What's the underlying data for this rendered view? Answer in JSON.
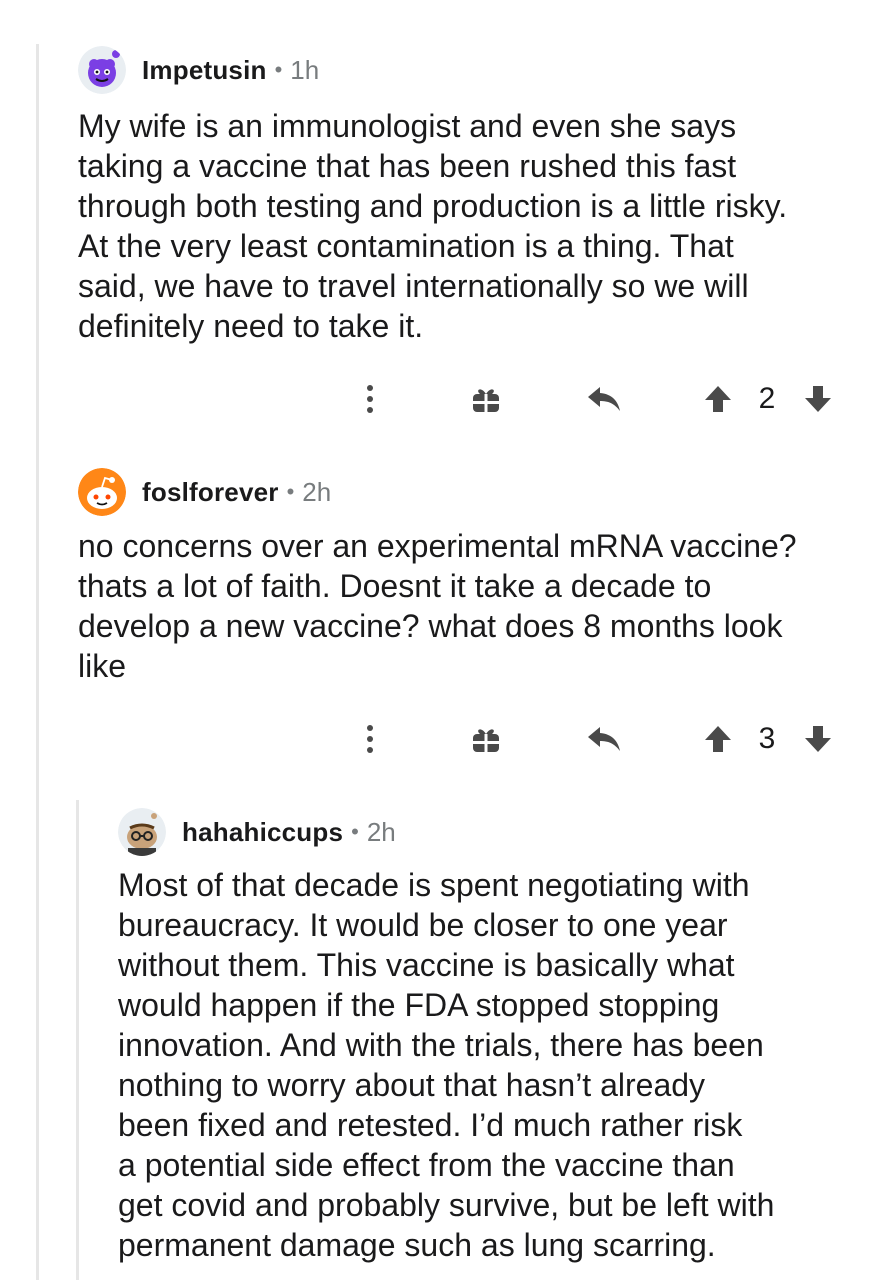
{
  "comments": [
    {
      "username": "Impetusin",
      "separator": "•",
      "time": "1h",
      "avatar_icon": "snoo-avatar-purple-icon",
      "body": "My wife is an immunologist and even she says\ntaking a vaccine that has been rushed this fast\nthrough both testing and production is a little risky.\nAt the very least contamination is a thing.  That\nsaid, we have to travel internationally so we will\ndefinitely need to take it.",
      "score": "2"
    },
    {
      "username": "foslforever",
      "separator": "•",
      "time": "2h",
      "avatar_icon": "snoo-avatar-orange-icon",
      "body": "no concerns over an experimental mRNA vaccine?\nthats a lot of faith. Doesnt it take a decade to\ndevelop a new vaccine? what does 8 months look\nlike",
      "score": "3"
    },
    {
      "username": "hahahiccups",
      "separator": "•",
      "time": "2h",
      "avatar_icon": "snoo-avatar-glasses-icon",
      "body": "Most of that decade is spent negotiating with\nbureaucracy. It would be closer to one year\nwithout them. This vaccine is basically what\nwould happen if the FDA stopped stopping\ninnovation. And with the trials, there has been\nnothing to worry about that hasn’t already\nbeen fixed and retested. I’d much rather risk\na potential side effect from the vaccine than\nget covid and probably survive, but be left with\npermanent damage such as lung scarring."
    }
  ],
  "icons": {
    "more": "more-options-icon",
    "award": "award-gift-icon",
    "reply": "reply-arrow-icon",
    "upvote": "upvote-arrow-icon",
    "downvote": "downvote-arrow-icon"
  },
  "colors": {
    "text": "#1a1a1b",
    "meta": "#787c7e",
    "thread_line": "#e6e6e6",
    "icon": "#4a4a4a"
  }
}
